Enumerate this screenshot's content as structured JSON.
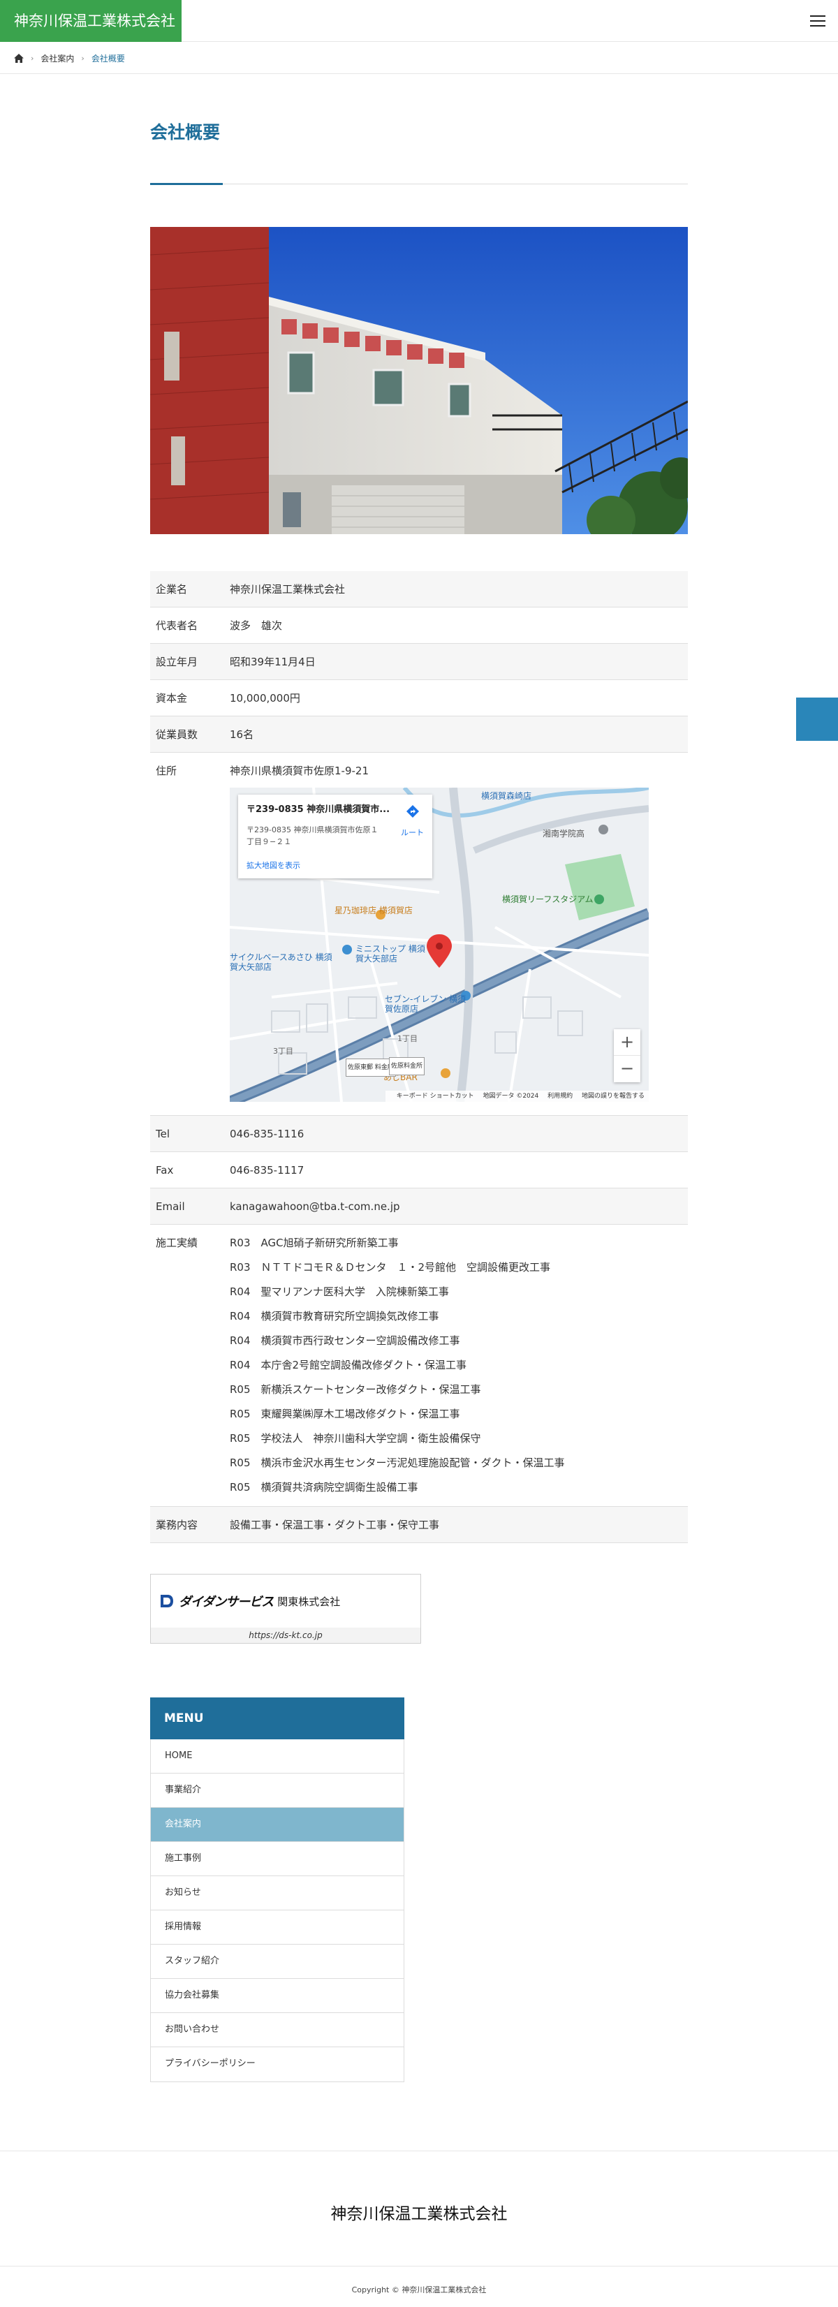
{
  "header": {
    "logo_text": "神奈川保温工業株式会社"
  },
  "breadcrumb": {
    "items": [
      "会社案内",
      "会社概要"
    ]
  },
  "page": {
    "title": "会社概要"
  },
  "info": [
    {
      "label": "企業名",
      "value": "神奈川保温工業株式会社"
    },
    {
      "label": "代表者名",
      "value": "波多　雄次"
    },
    {
      "label": "設立年月",
      "value": "昭和39年11月4日"
    },
    {
      "label": "資本金",
      "value": "10,000,000円"
    },
    {
      "label": "従業員数",
      "value": "16名"
    },
    {
      "label": "住所",
      "value": "神奈川県横須賀市佐原1-9-21"
    },
    {
      "label": "Tel",
      "value": "046-835-1116"
    },
    {
      "label": "Fax",
      "value": "046-835-1117"
    },
    {
      "label": "Email",
      "value": "kanagawahoon@tba.t-com.ne.jp"
    },
    {
      "label": "施工実績",
      "value": ""
    },
    {
      "label": "業務内容",
      "value": "設備工事・保温工事・ダクト工事・保守工事"
    }
  ],
  "works": [
    "R03　AGC旭硝子新研究所新築工事",
    "R03　ＮＴＴドコモＲ＆Ｄセンタ　１・2号館他　空調設備更改工事",
    "R04　聖マリアンナ医科大学　入院棟新築工事",
    "R04　横須賀市教育研究所空調換気改修工事",
    "R04　横須賀市西行政センター空調設備改修工事",
    "R04　本庁舎2号館空調設備改修ダクト・保温工事",
    "R05　新横浜スケートセンター改修ダクト・保温工事",
    "R05　東耀興業㈱厚木工場改修ダクト・保温工事",
    "R05　学校法人　神奈川歯科大学空調・衛生設備保守",
    "R05　横浜市金沢水再生センター汚泥処理施設配管・ダクト・保温工事",
    "R05　横須賀共済病院空調衛生設備工事"
  ],
  "map": {
    "card_title": "〒239-0835 神奈川県横須賀市...",
    "card_address": "〒239-0835 神奈川県横須賀市佐原１丁目９−２１",
    "card_link": "拡大地図を表示",
    "route_label": "ルート",
    "zoom_in": "+",
    "zoom_out": "−",
    "footer_items": [
      "キーボード ショートカット",
      "地図データ ©2024",
      "利用規約",
      "地図の誤りを報告する"
    ],
    "labels": {
      "stadium": "横須賀リーフスタジアム",
      "coffee": "星乃珈琲店 横須賀店",
      "ministop": "ミニストップ 横須賀大矢部店",
      "seven": "セブン-イレブン 横須賀佐原店",
      "school": "湘南学院高",
      "cycle": "サイクルベースあさひ 横須賀大矢部店",
      "bar": "あじBAR",
      "forest": "横須賀森崎店",
      "cho1": "1丁目",
      "cho3": "3丁目",
      "parking1": "佐原東郵 料金所",
      "parking2": "佐原料金所"
    }
  },
  "banner": {
    "brand": "ダイダンサービス",
    "name": "関東株式会社",
    "url": "https://ds-kt.co.jp"
  },
  "menu": {
    "title": "MENU",
    "items": [
      "HOME",
      "事業紹介",
      "会社案内",
      "施工事例",
      "お知らせ",
      "採用情報",
      "スタッフ紹介",
      "協力会社募集",
      "お問い合わせ",
      "プライバシーポリシー"
    ],
    "active_index": 2
  },
  "footer": {
    "company": "神奈川保温工業株式会社",
    "copyright": "Copyright © 神奈川保温工業株式会社"
  },
  "colors": {
    "brand_green": "#3aa34d",
    "accent_blue": "#1f6e9a",
    "menu_active": "#7fb6cd",
    "side_tab": "#2a86b9"
  }
}
